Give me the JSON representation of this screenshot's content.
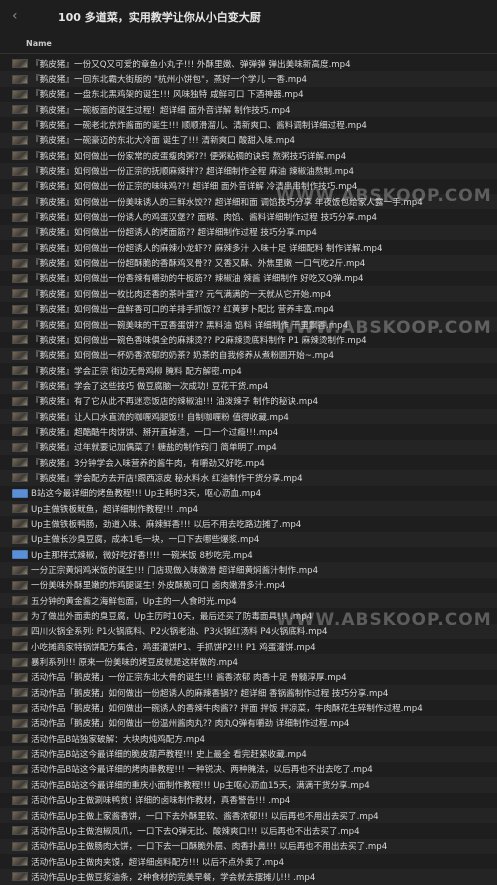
{
  "header": {
    "title": "100 多道菜，实用教学让你从小白变大厨",
    "column_name": "Name"
  },
  "watermark": "WWW.ABSKOOP.COM",
  "files": [
    {
      "type": "video",
      "name": "『鹅皮猪』一份又Q又可爱的章鱼小丸子!!! 外酥里嫩、弹弹弹 弹出美味新高度.mp4"
    },
    {
      "type": "video",
      "name": "『鹅皮猪』一回东北霸大街版的 \"杭州小饼包\"，蒸好一个学儿 一香.mp4"
    },
    {
      "type": "video",
      "name": "『鹅皮猪』一盘东北黑鸡架的诞生!!! 风味独特 咸鲜可口 下酒神器.mp4"
    },
    {
      "type": "video",
      "name": "『鹅皮猪』一碗板面的诞生过程！超详细 面外音详解 制作技巧.mp4"
    },
    {
      "type": "video",
      "name": "『鹅皮猪』一碗老北京炸酱面的诞生!!! 顺顺滑溜儿、清新爽口、酱料调制详细过程.mp4"
    },
    {
      "type": "video",
      "name": "『鹅皮猪』一碗豪迈的东北大冷面 诞生了!!! 清新爽口 酸甜入味.mp4"
    },
    {
      "type": "video",
      "name": "『鹅皮猪』如何做出一份家常的皮蛋瘦肉粥??! 便粥粘稠的诀窍 熬粥技巧详解.mp4"
    },
    {
      "type": "video",
      "name": "『鹅皮猪』如何做出一份正宗的抚顺麻辣拌?? 超详细制作全程 麻油 辣椒油熬制.mp4"
    },
    {
      "type": "video",
      "name": "『鹅皮猪』如何做出一份正宗的味味鸡??! 超详细 面外音详解 冷清串串制作技巧.mp4"
    },
    {
      "type": "video",
      "name": "『鹅皮猪』如何做出一份美味诱人的三鲜水饺?? 超详细和面 调馅技巧分享 年夜饭包给家人露一手.mp4"
    },
    {
      "type": "video",
      "name": "『鹅皮猪』如何做出一份诱人的鸡蛋汉堡?? 面糊、肉馅、酱料详细制作过程 技巧分享.mp4"
    },
    {
      "type": "video",
      "name": "『鹅皮猪』如何做出一份超诱人的烤面筋?? 超详细制作过程 技巧分享.mp4"
    },
    {
      "type": "video",
      "name": "『鹅皮猪』如何做出一份超诱人的麻辣小龙虾?? 麻辣多汁 入味十足 详细配料 制作详解.mp4"
    },
    {
      "type": "video",
      "name": "『鹅皮猪』如何做出一份超酥脆的香酥鸡叉骨?? 又香又酥、外焦里嫩 一口气吃2斤.mp4"
    },
    {
      "type": "video",
      "name": "『鹅皮猪』如何做出一份香辣有嚼劲的牛板筋?? 辣椒油 辣酱 详细制作 好吃又Q弹.mp4"
    },
    {
      "type": "video",
      "name": "『鹅皮猪』如何做出一枚比肉还香的茶叶蛋?? 元气满满的一天就从它开始.mp4"
    },
    {
      "type": "video",
      "name": "『鹅皮猪』如何做出一盘鲜香可口的羊排手抓饭?? 红黄萝卜配比 营养丰富.mp4"
    },
    {
      "type": "video",
      "name": "『鹅皮猪』如何做出一碗美味的干豆香蛋饼?? 黑料油 馅料 详细制作 干里飘香.mp4"
    },
    {
      "type": "video",
      "name": "『鹅皮猪』如何做出一碗色香味俱全的麻辣烫?? P2麻辣烫底料制作 P1 麻辣烫制作.mp4"
    },
    {
      "type": "video",
      "name": "『鹅皮猪』如何做出一杯奶香浓郁的奶茶? 奶茶的自我修养从煮粉圆开始~.mp4"
    },
    {
      "type": "video",
      "name": "『鹅皮猪』学会正宗 街边无骨鸡柳 腌料 配方解密.mp4"
    },
    {
      "type": "video",
      "name": "『鹅皮猪』学会了这些技巧 做豆腐脑一次成功! 豆花干货.mp4"
    },
    {
      "type": "video",
      "name": "『鹅皮猪』有了它从此不再迷恋饭店的辣椒油!!! 油泼辣子 制作的秘诀.mp4"
    },
    {
      "type": "video",
      "name": "『鹅皮猪』让人口水直流的咖喱鸡腿饭!! 自制咖喱粉 值得收藏.mp4"
    },
    {
      "type": "video",
      "name": "『鹅皮猪』超酷酷牛肉饼饼、掰开直掉渣，一口一个过瘾!!!.mp4"
    },
    {
      "type": "video",
      "name": "『鹅皮猪』过年就要记加偶菜了! 糖盐的制作窍门 简单明了.mp4"
    },
    {
      "type": "video",
      "name": "『鹅皮猪』3分钟学会入味营养的酱牛肉，有嚼劲又好吃.mp4"
    },
    {
      "type": "video",
      "name": "『鹅皮猪』学会配方去开店!跟西凉皮 秘水料水 红油制作干货分享.mp4"
    },
    {
      "type": "folder",
      "name": "B站这今最详细的烤鱼教程!!! Up主耗时3天，呕心沥血.mp4"
    },
    {
      "type": "video",
      "name": "Up主做铁板鱿鱼，超详细制作教程!!! .mp4"
    },
    {
      "type": "video",
      "name": "Up主做铁板鸭肠，劲道入味、麻辣鲜香!!! 以后不用去吃路边摊了.mp4"
    },
    {
      "type": "video",
      "name": "Up主做长沙臭豆腐，成本1毛一块，一口下去哪些爆浆.mp4"
    },
    {
      "type": "folder",
      "name": "Up主那样式辣椒，微好吃好香!!!! 一碗米饭 8秒吃完.mp4"
    },
    {
      "type": "video",
      "name": "一分正宗黄焖鸡米饭的诞生!!! 门店现做入味嫩滑 超详细黄焖酱汁制作.mp4"
    },
    {
      "type": "video",
      "name": "一份美味外酥里嫩的炸鸡腿诞生! 外皮酥脆可口 卤肉嫩滑多汁.mp4"
    },
    {
      "type": "video",
      "name": "五分钟的黄金酱之海鲜包面，Up主的一人食时光.mp4"
    },
    {
      "type": "video",
      "name": "为了做出外面卖的臭豆腐，Up主历时10天，最后还买了防毒面具!!! .mp4"
    },
    {
      "type": "video",
      "name": "四川火锅全系列: P1火锅底料、P2火锅老油、P3火锅红汤料 P4火锅底料.mp4"
    },
    {
      "type": "video",
      "name": "小吃摊商家特锅饼配方集合，鸡蛋灌饼P1、手抓饼P2!!! P1 鸡蛋灌饼.mp4"
    },
    {
      "type": "video",
      "name": "暴利系列!!! 原来一份美味的烤豆皮就是这样做的.mp4"
    },
    {
      "type": "video",
      "name": "活动作品「鹅皮猪」一份正宗东北大骨的诞生!!! 酱香浓郁 肉香十足 骨髓淳厚.mp4"
    },
    {
      "type": "video",
      "name": "活动作品「鹅皮猪」如何做出一份超诱人的麻辣香锅?? 超详细 香锅酱制作过程 技巧分享.mp4"
    },
    {
      "type": "video",
      "name": "活动作品「鹅皮猪」如何做出一碗诱人的香辣牛肉酱?? 拌面 拌饭 拌凉菜，牛肉酥花生碎制作过程.mp4"
    },
    {
      "type": "video",
      "name": "活动作品「鹅皮猪」如何做出一份温州酱肉丸?? 肉丸Q弹有嚼劲 详细制作过程.mp4"
    },
    {
      "type": "video",
      "name": "活动作品B站独家破解：大块肉炖鸡配方.mp4"
    },
    {
      "type": "video",
      "name": "活动作品B站这今最详细的脆皮葫芦教程!!! 史上最全 看完赶紧收藏.mp4"
    },
    {
      "type": "video",
      "name": "活动作品B站这今最详细的烤肉串教程!!! 一种锐决、两种腌法，以后再也不出去吃了.mp4"
    },
    {
      "type": "video",
      "name": "活动作品B站这今最详细的重庆小面制作教程!!! Up主呕心沥血15天，满满干货分享.mp4"
    },
    {
      "type": "video",
      "name": "活动作品Up主做涮味鸭贫! 详细的卤味制作教材，真香警告!!! .mp4"
    },
    {
      "type": "video",
      "name": "活动作品Up主做上家酱香饼，一口下去外酥里软、酱香浓郁!!! 以后再也不用出去买了.mp4"
    },
    {
      "type": "video",
      "name": "活动作品Up主做泡椒凤爪，一口下去Q弹无比、酸辣爽口!!! 以后再也不出去买了.mp4"
    },
    {
      "type": "video",
      "name": "活动作品Up主做肠肉大饼，一口下去一口酥脆外层、肉香扑鼻!!! 以后再也不用出去买了.mp4"
    },
    {
      "type": "video",
      "name": "活动作品Up主做肉夹馍，超详细卤料配方!!! 以后不点外卖了.mp4"
    },
    {
      "type": "video",
      "name": "活动作品Up主做豆浆油条，2种食材的完美早餐，学会就去摆摊儿!!! .mp4"
    }
  ]
}
